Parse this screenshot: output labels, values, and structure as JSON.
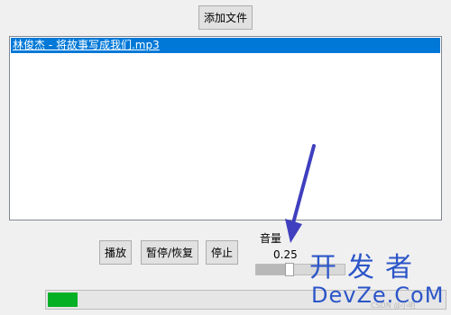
{
  "toolbar": {
    "add_file_label": "添加文件"
  },
  "playlist": {
    "items": [
      {
        "label": "林俊杰 - 将故事写成我们.mp3",
        "selected": true
      }
    ]
  },
  "controls": {
    "play_label": "播放",
    "pause_resume_label": "暂停/恢复",
    "stop_label": "停止"
  },
  "volume": {
    "label": "音量",
    "value_text": "0.25",
    "level": 0.25
  },
  "playback_progress": {
    "fraction": 0.075
  },
  "colors": {
    "selection": "#0078d7",
    "progress_fill": "#06b025",
    "annotation_arrow": "#3f3fbf",
    "watermark": "#2b55c8"
  },
  "watermark": {
    "title": "开发者",
    "subtitle": "DevZe.CoM",
    "faint_text": "CSDN @小明"
  }
}
